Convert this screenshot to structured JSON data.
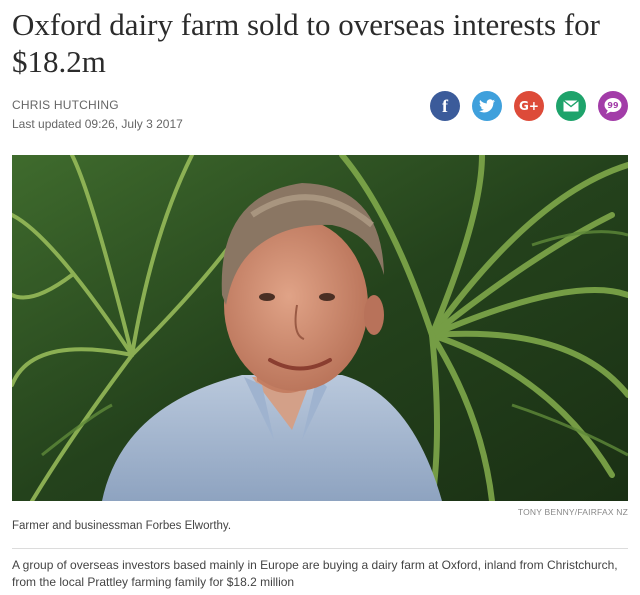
{
  "article": {
    "headline": "Oxford dairy farm sold to overseas interests for $18.2m",
    "author": "CHRIS HUTCHING",
    "updated": "Last updated 09:26, July 3 2017",
    "share": {
      "facebook": "f",
      "twitter": "twitter-bird-icon",
      "googleplus": "G+",
      "email": "email-icon",
      "comments": "99"
    },
    "photo_credit": "TONY BENNY/FAIRFAX NZ",
    "caption": "Farmer and businessman Forbes Elworthy.",
    "lede": "A group of overseas investors based mainly in Europe are buying a dairy farm at Oxford, inland from Christchurch, from the local Prattley farming family for $18.2 million"
  },
  "colors": {
    "facebook": "#3b5b9a",
    "twitter": "#3fa0dc",
    "googleplus": "#dd4b39",
    "email": "#1ea36b",
    "comments": "#a23ca8"
  }
}
